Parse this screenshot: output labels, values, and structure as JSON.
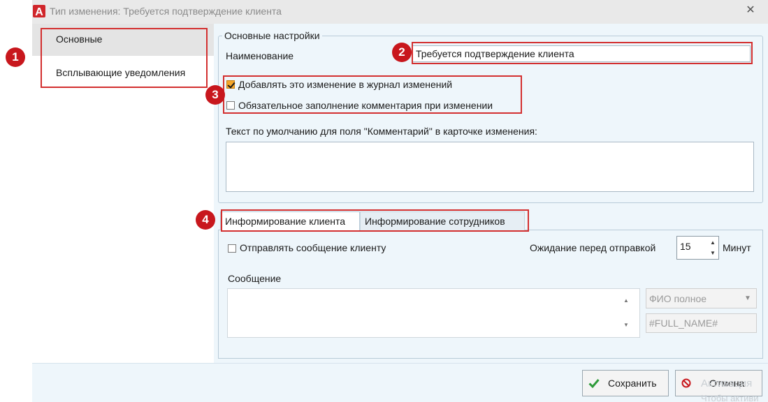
{
  "window": {
    "title": "Тип изменения: Требуется подтверждение клиента",
    "close_glyph": "✕",
    "logo_letter": "A"
  },
  "sidebar": {
    "items": [
      {
        "label": "Основные",
        "selected": true
      },
      {
        "label": "Всплывающие уведомления",
        "selected": false
      }
    ]
  },
  "main_settings": {
    "group_title": "Основные настройки",
    "name_label": "Наименование",
    "name_value": "Требуется подтверждение клиента",
    "log_changes_label": "Добавлять это изменение в журнал изменений",
    "log_changes_checked": true,
    "require_comment_label": "Обязательное заполнение комментария при изменении",
    "require_comment_checked": false,
    "default_comment_label": "Текст по умолчанию для поля \"Комментарий\" в карточке изменения:",
    "default_comment_value": ""
  },
  "tabs": [
    {
      "label": "Информирование клиента",
      "active": true
    },
    {
      "label": "Информирование сотрудников",
      "active": false
    }
  ],
  "client_tab": {
    "send_message_label": "Отправлять сообщение клиенту",
    "send_message_checked": false,
    "wait_label": "Ожидание перед отправкой",
    "wait_value": "15",
    "wait_unit": "Минут",
    "message_label": "Сообщение",
    "message_value": "",
    "field_select_value": "ФИО полное",
    "field_code_value": "#FULL_NAME#"
  },
  "footer": {
    "save_label": "Сохранить",
    "cancel_label": "Отмена"
  },
  "callouts": [
    "1",
    "2",
    "3",
    "4"
  ],
  "watermark": {
    "line1": "Активация",
    "line2": "Чтобы активи"
  },
  "colors": {
    "accent_red": "#c8171d",
    "panel_bg": "#eef6fb",
    "checkbox_checked": "#f4a62a",
    "save_check": "#2e9b3a",
    "cancel_icon": "#c8171d"
  }
}
